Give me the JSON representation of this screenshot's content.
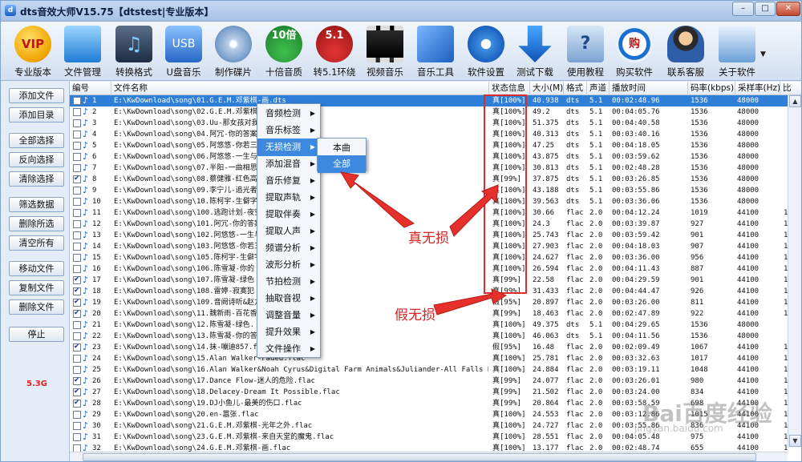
{
  "window": {
    "title": "dts音效大师V15.75【dtstest|专业版本】",
    "min": "–",
    "max": "□",
    "close": "✕"
  },
  "toolbar": [
    {
      "label": "专业版本",
      "icon": "vip-icon"
    },
    {
      "label": "文件管理",
      "icon": "folder-icon"
    },
    {
      "label": "转换格式",
      "icon": "music-convert-icon"
    },
    {
      "label": "U盘音乐",
      "icon": "usb-drive-icon"
    },
    {
      "label": "制作碟片",
      "icon": "cd-icon"
    },
    {
      "label": "十倍音质",
      "icon": "ten-times-icon",
      "badge": "10倍"
    },
    {
      "label": "转5.1环绕",
      "icon": "surround-icon",
      "badge": "5.1"
    },
    {
      "label": "视频音乐",
      "icon": "film-icon"
    },
    {
      "label": "音乐工具",
      "icon": "tools-icon"
    },
    {
      "label": "软件设置",
      "icon": "gear-icon"
    },
    {
      "label": "测试下载",
      "icon": "download-icon"
    },
    {
      "label": "使用教程",
      "icon": "help-book-icon"
    },
    {
      "label": "购买软件",
      "icon": "buy-icon",
      "badge": "购"
    },
    {
      "label": "联系客服",
      "icon": "support-icon"
    },
    {
      "label": "关于软件",
      "icon": "about-computer-icon"
    }
  ],
  "left_buttons": [
    "添加文件",
    "添加目录",
    "全部选择",
    "反向选择",
    "清除选择",
    "筛选数据",
    "删除所选",
    "清空所有",
    "移动文件",
    "复制文件",
    "删除文件",
    "停止"
  ],
  "total_size": "5.3G",
  "columns": [
    "编号",
    "文件名称",
    "状态信息",
    "大小(M)",
    "格式",
    "声道",
    "播放时间",
    "码率(kbps)",
    "采样率(Hz)",
    "比"
  ],
  "rows": [
    {
      "n": "1",
      "name": "E:\\KwDownload\\song\\01.G.E.M.邓紫棋-画.dts",
      "status": "真[100%]",
      "size": "40.938",
      "fmt": "dts",
      "ch": "5.1",
      "time": "00:02:48.96",
      "rate": "1536",
      "sr": "48000",
      "bit": "",
      "chk": false
    },
    {
      "n": "2",
      "name": "E:\\KwDownload\\song\\02.G.E.M.邓紫棋",
      "status": "真[100%]",
      "size": "49.2",
      "fmt": "dts",
      "ch": "5.1",
      "time": "00:04:05.76",
      "rate": "1536",
      "sr": "48000",
      "bit": "",
      "chk": false
    },
    {
      "n": "3",
      "name": "E:\\KwDownload\\song\\03.Uu-那女孩对我",
      "status": "真[100%]",
      "size": "51.375",
      "fmt": "dts",
      "ch": "5.1",
      "time": "00:04:40.58",
      "rate": "1536",
      "sr": "48000",
      "bit": "",
      "chk": false
    },
    {
      "n": "4",
      "name": "E:\\KwDownload\\song\\04.阿冗-你的答案",
      "status": "真[100%]",
      "size": "40.313",
      "fmt": "dts",
      "ch": "5.1",
      "time": "00:03:40.16",
      "rate": "1536",
      "sr": "48000",
      "bit": "",
      "chk": false
    },
    {
      "n": "5",
      "name": "E:\\KwDownload\\song\\05.阿悠悠-你若三",
      "status": "真[100%]",
      "size": "47.25",
      "fmt": "dts",
      "ch": "5.1",
      "time": "00:04:18.05",
      "rate": "1536",
      "sr": "48000",
      "bit": "",
      "chk": false
    },
    {
      "n": "6",
      "name": "E:\\KwDownload\\song\\06.阿悠悠-一生与",
      "status": "真[100%]",
      "size": "43.875",
      "fmt": "dts",
      "ch": "5.1",
      "time": "00:03:59.62",
      "rate": "1536",
      "sr": "48000",
      "bit": "",
      "chk": false
    },
    {
      "n": "7",
      "name": "E:\\KwDownload\\song\\07.半阳-一曲相思",
      "status": "真[100%]",
      "size": "30.813",
      "fmt": "dts",
      "ch": "5.1",
      "time": "00:02:48.28",
      "rate": "1536",
      "sr": "48000",
      "bit": "",
      "chk": false
    },
    {
      "n": "8",
      "name": "E:\\KwDownload\\song\\08.蔡健雅-红色高",
      "status": "真[99%]",
      "size": "37.875",
      "fmt": "dts",
      "ch": "5.1",
      "time": "00:03:26.85",
      "rate": "1536",
      "sr": "48000",
      "bit": "",
      "chk": true
    },
    {
      "n": "9",
      "name": "E:\\KwDownload\\song\\09.李宁儿-追光者",
      "status": "真[100%]",
      "size": "43.188",
      "fmt": "dts",
      "ch": "5.1",
      "time": "00:03:55.86",
      "rate": "1536",
      "sr": "48000",
      "bit": "",
      "chk": false
    },
    {
      "n": "10",
      "name": "E:\\KwDownload\\song\\10.陈柯宇-生僻字",
      "status": "真[100%]",
      "size": "39.563",
      "fmt": "dts",
      "ch": "5.1",
      "time": "00:03:36.06",
      "rate": "1536",
      "sr": "48000",
      "bit": "",
      "chk": false
    },
    {
      "n": "11",
      "name": "E:\\KwDownload\\song\\100.逃跑计划-夜空",
      "status": "真[100%]",
      "size": "30.66",
      "fmt": "flac",
      "ch": "2.0",
      "time": "00:04:12.24",
      "rate": "1019",
      "sr": "44100",
      "bit": "1",
      "chk": false
    },
    {
      "n": "12",
      "name": "E:\\KwDownload\\song\\101.阿冗-你的答案",
      "status": "真[100%]",
      "size": "24.3",
      "fmt": "flac",
      "ch": "2.0",
      "time": "00:03:39.87",
      "rate": "927",
      "sr": "44100",
      "bit": "1",
      "chk": false
    },
    {
      "n": "13",
      "name": "E:\\KwDownload\\song\\102.阿悠悠-一生与",
      "status": "真[100%]",
      "size": "25.743",
      "fmt": "flac",
      "ch": "2.0",
      "time": "00:03:59.42",
      "rate": "901",
      "sr": "44100",
      "bit": "1",
      "chk": false
    },
    {
      "n": "14",
      "name": "E:\\KwDownload\\song\\103.阿悠悠-你若三",
      "status": "真[100%]",
      "size": "27.903",
      "fmt": "flac",
      "ch": "2.0",
      "time": "00:04:18.03",
      "rate": "907",
      "sr": "44100",
      "bit": "1",
      "chk": false
    },
    {
      "n": "15",
      "name": "E:\\KwDownload\\song\\105.陈柯宇-生僻字",
      "status": "真[100%]",
      "size": "24.627",
      "fmt": "flac",
      "ch": "2.0",
      "time": "00:03:36.00",
      "rate": "956",
      "sr": "44100",
      "bit": "1",
      "chk": false
    },
    {
      "n": "16",
      "name": "E:\\KwDownload\\song\\106.陈雪凝-你的",
      "status": "真[100%]",
      "size": "26.594",
      "fmt": "flac",
      "ch": "2.0",
      "time": "00:04:11.43",
      "rate": "887",
      "sr": "44100",
      "bit": "1",
      "chk": false
    },
    {
      "n": "17",
      "name": "E:\\KwDownload\\song\\107.陈雪凝-绿色",
      "status": "真[99%]",
      "size": "22.58",
      "fmt": "flac",
      "ch": "2.0",
      "time": "00:04:29.59",
      "rate": "901",
      "sr": "44100",
      "bit": "1",
      "chk": true
    },
    {
      "n": "18",
      "name": "E:\\KwDownload\\song\\108.雷婷-寂寞犯",
      "status": "真[99%]",
      "size": "31.433",
      "fmt": "flac",
      "ch": "2.0",
      "time": "00:04:44.47",
      "rate": "926",
      "sr": "44100",
      "bit": "1",
      "chk": true
    },
    {
      "n": "19",
      "name": "E:\\KwDownload\\song\\109.音阙诗听&赵方",
      "status": "假[95%]",
      "size": "20.897",
      "fmt": "flac",
      "ch": "2.0",
      "time": "00:03:26.00",
      "rate": "811",
      "sr": "44100",
      "bit": "1",
      "chk": true
    },
    {
      "n": "20",
      "name": "E:\\KwDownload\\song\\11.魏新雨-百花香",
      "status": "真[99%]",
      "size": "18.463",
      "fmt": "flac",
      "ch": "2.0",
      "time": "00:02:47.89",
      "rate": "922",
      "sr": "44100",
      "bit": "1",
      "chk": true
    },
    {
      "n": "21",
      "name": "E:\\KwDownload\\song\\12.陈雪凝-绿色.",
      "status": "真[100%]",
      "size": "49.375",
      "fmt": "dts",
      "ch": "5.1",
      "time": "00:04:29.65",
      "rate": "1536",
      "sr": "48000",
      "bit": "",
      "chk": false
    },
    {
      "n": "22",
      "name": "E:\\KwDownload\\song\\13.陈雪凝-你的答",
      "status": "真[100%]",
      "size": "46.063",
      "fmt": "dts",
      "ch": "5.1",
      "time": "00:04:11.56",
      "rate": "1536",
      "sr": "48000",
      "bit": "",
      "chk": false
    },
    {
      "n": "23",
      "name": "E:\\KwDownload\\song\\14.抹-嘣迪857.f",
      "status": "假[95%]",
      "size": "16.48",
      "fmt": "flac",
      "ch": "2.0",
      "time": "00:02:09.49",
      "rate": "1067",
      "sr": "44100",
      "bit": "1",
      "chk": true
    },
    {
      "n": "24",
      "name": "E:\\KwDownload\\song\\15.Alan Walker-Faded.flac",
      "status": "真[100%]",
      "size": "25.781",
      "fmt": "flac",
      "ch": "2.0",
      "time": "00:03:32.63",
      "rate": "1017",
      "sr": "44100",
      "bit": "1",
      "chk": false
    },
    {
      "n": "25",
      "name": "E:\\KwDownload\\song\\16.Alan Walker&Noah Cyrus&Digital Farm Animals&Juliander-All Falls Down.flac",
      "status": "真[100%]",
      "size": "24.884",
      "fmt": "flac",
      "ch": "2.0",
      "time": "00:03:19.11",
      "rate": "1048",
      "sr": "44100",
      "bit": "1",
      "chk": false
    },
    {
      "n": "26",
      "name": "E:\\KwDownload\\song\\17.Dance Flow-迷人的危险.flac",
      "status": "真[99%]",
      "size": "24.077",
      "fmt": "flac",
      "ch": "2.0",
      "time": "00:03:26.01",
      "rate": "980",
      "sr": "44100",
      "bit": "1",
      "chk": true
    },
    {
      "n": "27",
      "name": "E:\\KwDownload\\song\\18.Delacey-Dream It Possible.flac",
      "status": "真[99%]",
      "size": "21.502",
      "fmt": "flac",
      "ch": "2.0",
      "time": "00:03:24.00",
      "rate": "834",
      "sr": "44100",
      "bit": "1",
      "chk": true
    },
    {
      "n": "28",
      "name": "E:\\KwDownload\\song\\19.DJ小鱼儿-最美的伤口.flac",
      "status": "真[99%]",
      "size": "20.864",
      "fmt": "flac",
      "ch": "2.0",
      "time": "00:03:58.59",
      "rate": "698",
      "sr": "44100",
      "bit": "1",
      "chk": true
    },
    {
      "n": "29",
      "name": "E:\\KwDownload\\song\\20.en-嚣张.flac",
      "status": "真[100%]",
      "size": "24.553",
      "fmt": "flac",
      "ch": "2.0",
      "time": "00:03:12.86",
      "rate": "1015",
      "sr": "44100",
      "bit": "1",
      "chk": false
    },
    {
      "n": "30",
      "name": "E:\\KwDownload\\song\\21.G.E.M.邓紫棋-光年之外.flac",
      "status": "真[100%]",
      "size": "24.727",
      "fmt": "flac",
      "ch": "2.0",
      "time": "00:03:55.86",
      "rate": "836",
      "sr": "44100",
      "bit": "1",
      "chk": false
    },
    {
      "n": "31",
      "name": "E:\\KwDownload\\song\\23.G.E.M.邓紫棋-来自天堂的魔鬼.flac",
      "status": "真[100%]",
      "size": "28.551",
      "fmt": "flac",
      "ch": "2.0",
      "time": "00:04:05.48",
      "rate": "975",
      "sr": "44100",
      "bit": "1",
      "chk": false
    },
    {
      "n": "32",
      "name": "E:\\KwDownload\\song\\24.G.E.M.邓紫棋-画.flac",
      "status": "真[100%]",
      "size": "13.177",
      "fmt": "flac",
      "ch": "2.0",
      "time": "00:02:48.74",
      "rate": "655",
      "sr": "44100",
      "bit": "1",
      "chk": false
    }
  ],
  "context_menu": [
    "音频检测",
    "音乐标签",
    "无损检测",
    "添加混音",
    "音乐修复",
    "提取声轨",
    "提取伴奏",
    "提取人声",
    "频谱分析",
    "波形分析",
    "节拍检测",
    "抽取音视",
    "调整音量",
    "提升效果",
    "文件操作"
  ],
  "submenu": [
    "本曲",
    "全部"
  ],
  "annotations": {
    "true_lossless": "真无损",
    "fake_lossless": "假无损"
  },
  "watermark": {
    "main": "Bai百度经验",
    "sub": "jingyan.baidu.com"
  },
  "colors": {
    "selection": "#2f7fd8",
    "menu_highlight": "#3d89e0",
    "annotation": "#e02b2b"
  }
}
